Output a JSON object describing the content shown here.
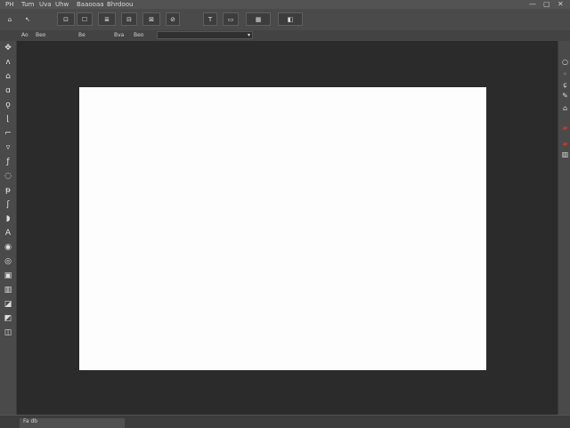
{
  "menubar": {
    "items": [
      "PH",
      "Tum",
      "Uva",
      "Uhw",
      "Baaooaa",
      "Bhrdoou"
    ],
    "window_controls": [
      "—",
      "▢",
      "✕"
    ]
  },
  "toolbar": {
    "buttons": [
      {
        "icon": "home-icon",
        "glyph": "⌂"
      },
      {
        "icon": "move-icon",
        "glyph": "↖"
      },
      {
        "icon": "zoom-icon",
        "glyph": "⊡"
      },
      {
        "icon": "hand-icon",
        "glyph": "☐"
      },
      {
        "icon": "layers-icon",
        "glyph": "≣"
      },
      {
        "icon": "crop-icon",
        "glyph": "⊟"
      },
      {
        "icon": "transform-icon",
        "glyph": "⊠"
      },
      {
        "icon": "brush-icon",
        "glyph": "⊘"
      },
      {
        "icon": "text-icon",
        "glyph": "T"
      },
      {
        "icon": "shape-icon",
        "glyph": "▭"
      },
      {
        "icon": "grid-icon",
        "glyph": "▦"
      },
      {
        "icon": "color-icon",
        "glyph": "◧"
      }
    ]
  },
  "optionsbar": {
    "items": [
      "Ao",
      "Beo",
      "Be",
      "Bva",
      "Beo"
    ],
    "dropdown_arrow": "▾"
  },
  "tools": [
    {
      "icon": "move-tool-icon",
      "glyph": "✥"
    },
    {
      "icon": "lasso-tool-icon",
      "glyph": "ʌ"
    },
    {
      "icon": "marquee-tool-icon",
      "glyph": "⌂"
    },
    {
      "icon": "magic-wand-icon",
      "glyph": "ɑ"
    },
    {
      "icon": "crop-tool-icon",
      "glyph": "ǫ"
    },
    {
      "icon": "slice-tool-icon",
      "glyph": "⌊"
    },
    {
      "icon": "eyedropper-icon",
      "glyph": "⌐"
    },
    {
      "icon": "heal-tool-icon",
      "glyph": "▿"
    },
    {
      "icon": "brush-tool-icon",
      "glyph": "ƒ"
    },
    {
      "icon": "clone-tool-icon",
      "glyph": "◌"
    },
    {
      "icon": "history-brush-icon",
      "glyph": "ᵽ"
    },
    {
      "icon": "eraser-icon",
      "glyph": "ʃ"
    },
    {
      "icon": "gradient-icon",
      "glyph": "◗"
    },
    {
      "icon": "blur-icon",
      "glyph": "A"
    },
    {
      "icon": "dodge-icon",
      "glyph": "◉"
    },
    {
      "icon": "pen-icon",
      "glyph": "◎"
    },
    {
      "icon": "type-icon",
      "glyph": "▣"
    },
    {
      "icon": "path-select-icon",
      "glyph": "▥"
    },
    {
      "icon": "shape-tool-icon",
      "glyph": "◪"
    },
    {
      "icon": "hand-tool-icon",
      "glyph": "◩"
    },
    {
      "icon": "zoom-tool-icon",
      "glyph": "◫"
    }
  ],
  "right_tools": [
    {
      "icon": "history-panel-icon",
      "glyph": "○"
    },
    {
      "icon": "properties-icon",
      "glyph": "◦"
    },
    {
      "icon": "adjustments-icon",
      "glyph": "ɕ"
    },
    {
      "icon": "styles-icon",
      "glyph": "✎"
    },
    {
      "icon": "paths-icon",
      "glyph": "⌂"
    },
    {
      "icon": "swatch-icon",
      "glyph": "▰"
    },
    {
      "icon": "color-panel-icon",
      "glyph": "▰"
    },
    {
      "icon": "layers-panel-icon",
      "glyph": "▥"
    }
  ],
  "colors": {
    "accent_red": "#c23b2b"
  },
  "statusbar": {
    "label": "Fa  db"
  }
}
